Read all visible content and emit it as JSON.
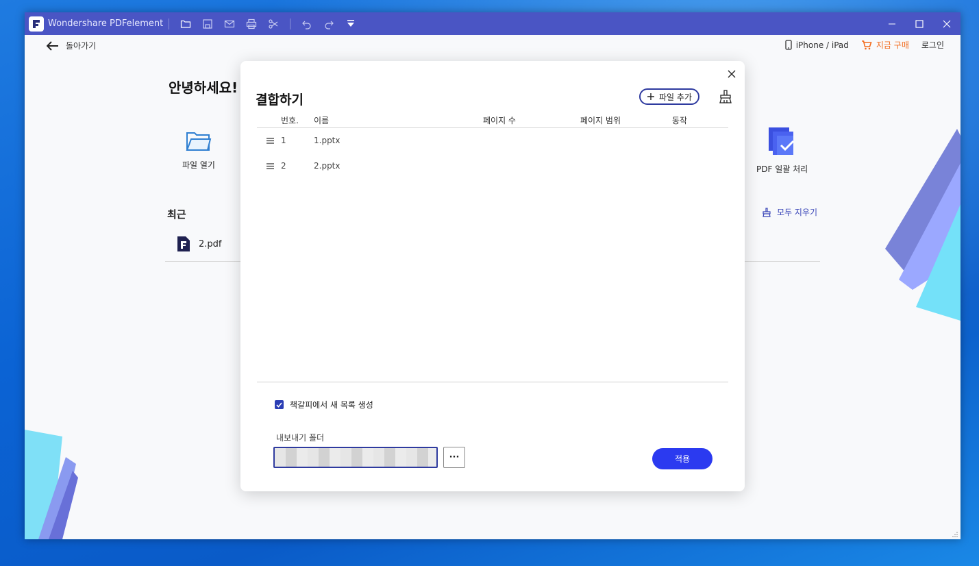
{
  "window": {
    "app_title": "Wondershare PDFelement"
  },
  "topbar": {
    "back_label": "돌아가기",
    "device_label": "iPhone / iPad",
    "buy_label": "지금 구매",
    "login_label": "로그인"
  },
  "home": {
    "greeting": "안녕하세요!",
    "open_file_label": "파일 열기",
    "batch_label": "PDF 일괄 처리",
    "recent_title": "최근",
    "clear_all_label": "모두 지우기",
    "recent_files": [
      {
        "name": "2.pdf"
      }
    ]
  },
  "dialog": {
    "title": "결합하기",
    "add_file_label": "파일 추가",
    "columns": {
      "number": "번호.",
      "name": "이름",
      "page_count": "페이지 수",
      "page_range": "페이지 범위",
      "action": "동작"
    },
    "rows": [
      {
        "number": "1",
        "name": "1.pptx"
      },
      {
        "number": "2",
        "name": "2.pptx"
      }
    ],
    "bookmark_checkbox_label": "책갈피에서 새 목록 생성",
    "bookmark_checked": true,
    "export_folder_label": "내보내기 폴더",
    "export_path_value": "",
    "browse_label": "···",
    "apply_label": "적용"
  },
  "colors": {
    "titlebar": "#4a55c4",
    "accent": "#2b3af0",
    "buy": "#f26a1b"
  }
}
